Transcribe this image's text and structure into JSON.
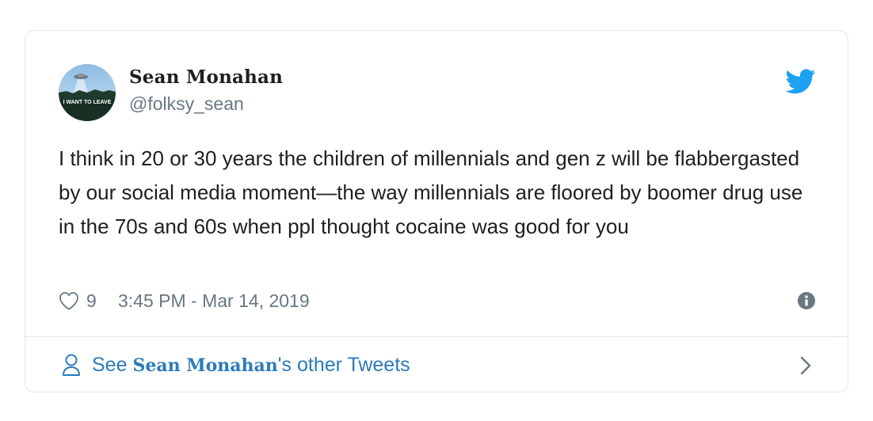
{
  "tweet": {
    "display_name": "Sean Monahan",
    "handle": "@folksy_sean",
    "avatar_caption": "I WANT TO LEAVE",
    "text": "I think in 20 or 30 years the children of millennials and gen z will be flabbergasted by our social media moment—the way millennials are floored by boomer drug use in the 70s and 60s when ppl thought cocaine was good for you",
    "likes": "9",
    "timestamp": "3:45 PM - Mar 14, 2019"
  },
  "footer": {
    "prefix": "See ",
    "name": "Sean Monahan",
    "suffix": "'s other Tweets"
  },
  "icons": {
    "bird": "twitter-bird-icon",
    "heart": "heart-icon",
    "info": "info-icon",
    "person": "person-icon",
    "chevron": "chevron-right-icon"
  },
  "colors": {
    "twitter_blue": "#1da1f2",
    "link_blue": "#2b7bb9",
    "text": "#1c2022",
    "muted": "#697882",
    "border": "#e1e8ed"
  }
}
